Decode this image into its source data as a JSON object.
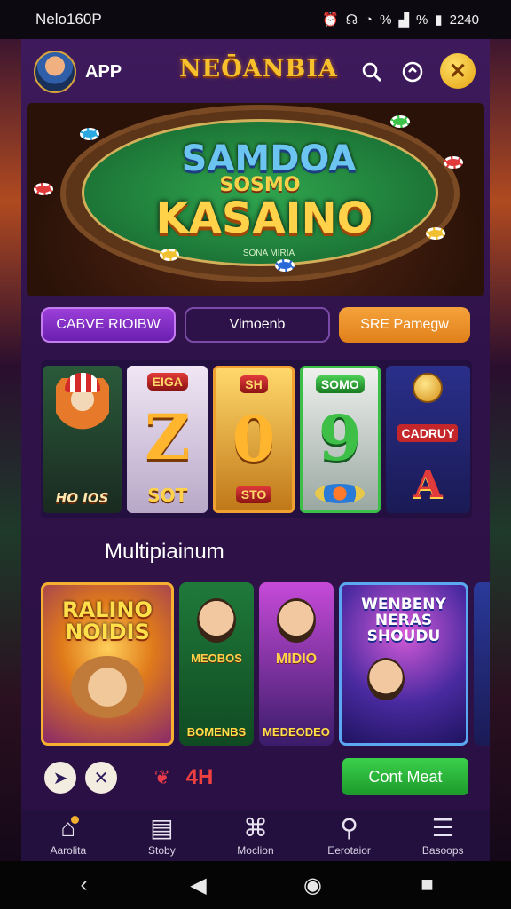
{
  "status_bar": {
    "carrier": "Nelo160P",
    "icons": [
      "alarm-icon",
      "headset-icon",
      "wifi-icon",
      "signal-icon",
      "battery-icon"
    ],
    "signal_text": "%",
    "signal_text2": "%",
    "time": "2240"
  },
  "header": {
    "label": "APP",
    "brand": "NEŌANBIA",
    "close_glyph": "✕"
  },
  "banner": {
    "line1": "SAMDOA",
    "line2": "SOSMO",
    "line3": "KASAINO",
    "subtext": "SONA MIRIA"
  },
  "pills": [
    {
      "label": "CABVE RIOIBW"
    },
    {
      "label": "Vimoenb"
    },
    {
      "label": "SRE Pamegw"
    }
  ],
  "slots": {
    "reel1_label": "HO IOS",
    "reel2_tag": "EIGA",
    "reel2_symbol": "Z",
    "reel2_label": "SOT",
    "reel3_tag": "SH",
    "reel3_symbol": "0",
    "reel3_label": "STO",
    "reel4_tag": "SOMO",
    "reel4_symbol": "9",
    "reel5_badge": "CADRUY",
    "reel5_symbol": "A"
  },
  "section": {
    "title": "Multipiainum"
  },
  "games": [
    {
      "title": "RALINO NOIDIS"
    },
    {
      "title": "MEOBOS",
      "caption": "BOMENBS"
    },
    {
      "title": "MIDIO",
      "caption": "MEDEODEO"
    },
    {
      "title": "WENBENY NERAS SHOUDU"
    }
  ],
  "actions": {
    "cta_label": "Cont Meat",
    "deco_text": "4H"
  },
  "bottom_nav": [
    {
      "icon": "home-icon",
      "label": "Aarolita"
    },
    {
      "icon": "wallet-icon",
      "label": "Stoby"
    },
    {
      "icon": "gift-icon",
      "label": "Moclion"
    },
    {
      "icon": "search-person-icon",
      "label": "Eerotaior"
    },
    {
      "icon": "menu-icon",
      "label": "Basoops"
    }
  ]
}
